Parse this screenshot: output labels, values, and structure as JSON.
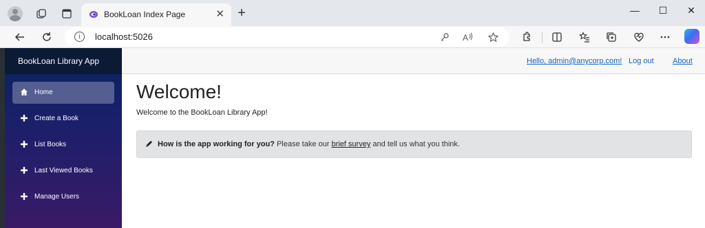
{
  "browser": {
    "tab": {
      "title": "BookLoan Index Page",
      "close": "✕"
    },
    "new_tab": "+",
    "window": {
      "minimize": "—",
      "maximize": "☐",
      "close": "✕"
    },
    "address": {
      "url": "localhost:5026"
    },
    "icons": [
      "profile-icon",
      "workspaces-icon",
      "vertical-tabs-icon",
      "tab-favicon",
      "back-icon",
      "refresh-icon",
      "info-icon",
      "key-icon",
      "read-aloud-icon",
      "favorite-icon",
      "extensions-icon",
      "split-screen-icon",
      "favorites-icon",
      "collections-icon",
      "browser-essentials-icon",
      "more-icon",
      "copilot-icon"
    ]
  },
  "app": {
    "brand": "BookLoan Library App",
    "nav": [
      {
        "label": "Home",
        "icon": "home-icon",
        "active": true
      },
      {
        "label": "Create a Book",
        "icon": "plus-icon"
      },
      {
        "label": "List Books",
        "icon": "plus-icon"
      },
      {
        "label": "Last Viewed Books",
        "icon": "plus-icon"
      },
      {
        "label": "Manage Users",
        "icon": "plus-icon"
      }
    ],
    "topbar": {
      "user_greeting": "Hello, admin@anycorp.com!",
      "logout": "Log out",
      "about": "About"
    },
    "main": {
      "heading": "Welcome!",
      "intro": "Welcome to the BookLoan Library App!",
      "survey": {
        "question": "How is the app working for you?",
        "prefix": " Please take our ",
        "link": "brief survey",
        "suffix": " and tell us what you think."
      }
    },
    "colors": {
      "sidebar_top": "#06245f",
      "sidebar_bottom": "#3a1a66",
      "brand_bar": "#0b1a35",
      "link": "#1565c0",
      "survey_bg": "#e2e3e5"
    }
  }
}
